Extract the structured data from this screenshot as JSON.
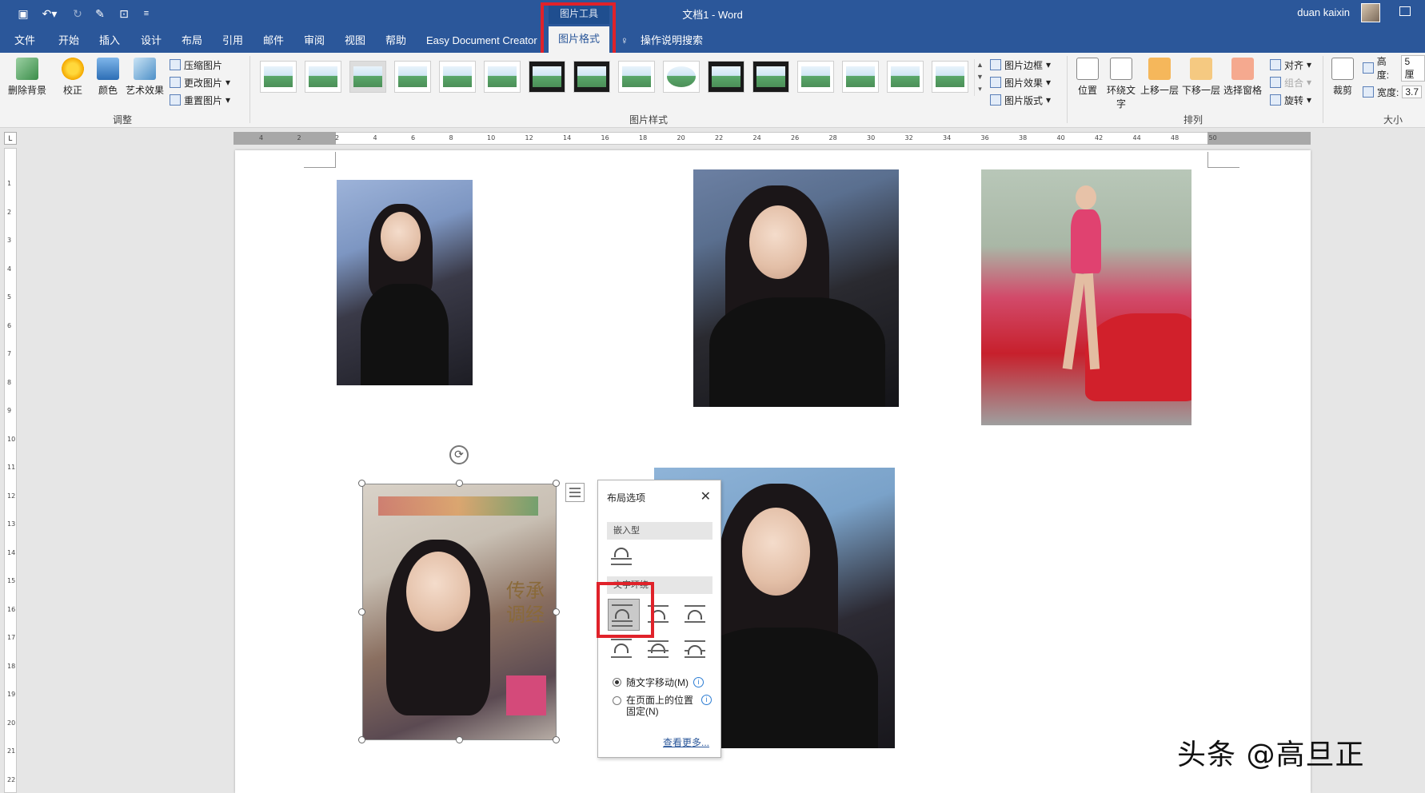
{
  "titlebar": {
    "doc_title": "文档1  -  Word",
    "tools_group": "图片工具",
    "user": "duan kaixin"
  },
  "tabs": [
    "文件",
    "开始",
    "插入",
    "设计",
    "布局",
    "引用",
    "邮件",
    "审阅",
    "视图",
    "帮助",
    "Easy Document Creator"
  ],
  "active_tab": "图片格式",
  "tell_me": "操作说明搜索",
  "ribbon": {
    "adjust": {
      "remove_bg": "删除背景",
      "corrections": "校正",
      "color": "颜色",
      "artistic": "艺术效果",
      "compress": "压缩图片",
      "change": "更改图片",
      "reset": "重置图片",
      "label": "调整"
    },
    "styles": {
      "label": "图片样式",
      "border": "图片边框",
      "effects": "图片效果",
      "layout": "图片版式"
    },
    "arrange": {
      "position": "位置",
      "wrap_text": "环绕文字",
      "bring_forward": "上移一层",
      "send_backward": "下移一层",
      "selection_pane": "选择窗格",
      "align": "对齐",
      "group": "组合",
      "rotate": "旋转",
      "label": "排列"
    },
    "size": {
      "crop": "裁剪",
      "height_label": "高度:",
      "height_value": "5 厘",
      "width_label": "宽度:",
      "width_value": "3.7",
      "label": "大小"
    }
  },
  "ruler": {
    "h_ticks": [
      "4",
      "2",
      "2",
      "4",
      "6",
      "8",
      "10",
      "12",
      "14",
      "16",
      "18",
      "20",
      "22",
      "24",
      "26",
      "28",
      "30",
      "32",
      "34",
      "36",
      "38",
      "40",
      "42",
      "44",
      "48",
      "50"
    ],
    "v_ticks": [
      "1",
      "2",
      "3",
      "4",
      "5",
      "6",
      "7",
      "8",
      "9",
      "10",
      "11",
      "12",
      "13",
      "14",
      "15",
      "16",
      "17",
      "18",
      "19",
      "20",
      "21",
      "22"
    ]
  },
  "layout_panel": {
    "title": "布局选项",
    "inline_section": "嵌入型",
    "wrap_section": "文字环绕",
    "move_with_text": "随文字移动(M)",
    "fix_position": "在页面上的位置固定(N)",
    "more": "查看更多..."
  },
  "watermark": "头条 @高旦正",
  "colors": {
    "word_blue": "#2b579a",
    "highlight_red": "#e0222a"
  }
}
